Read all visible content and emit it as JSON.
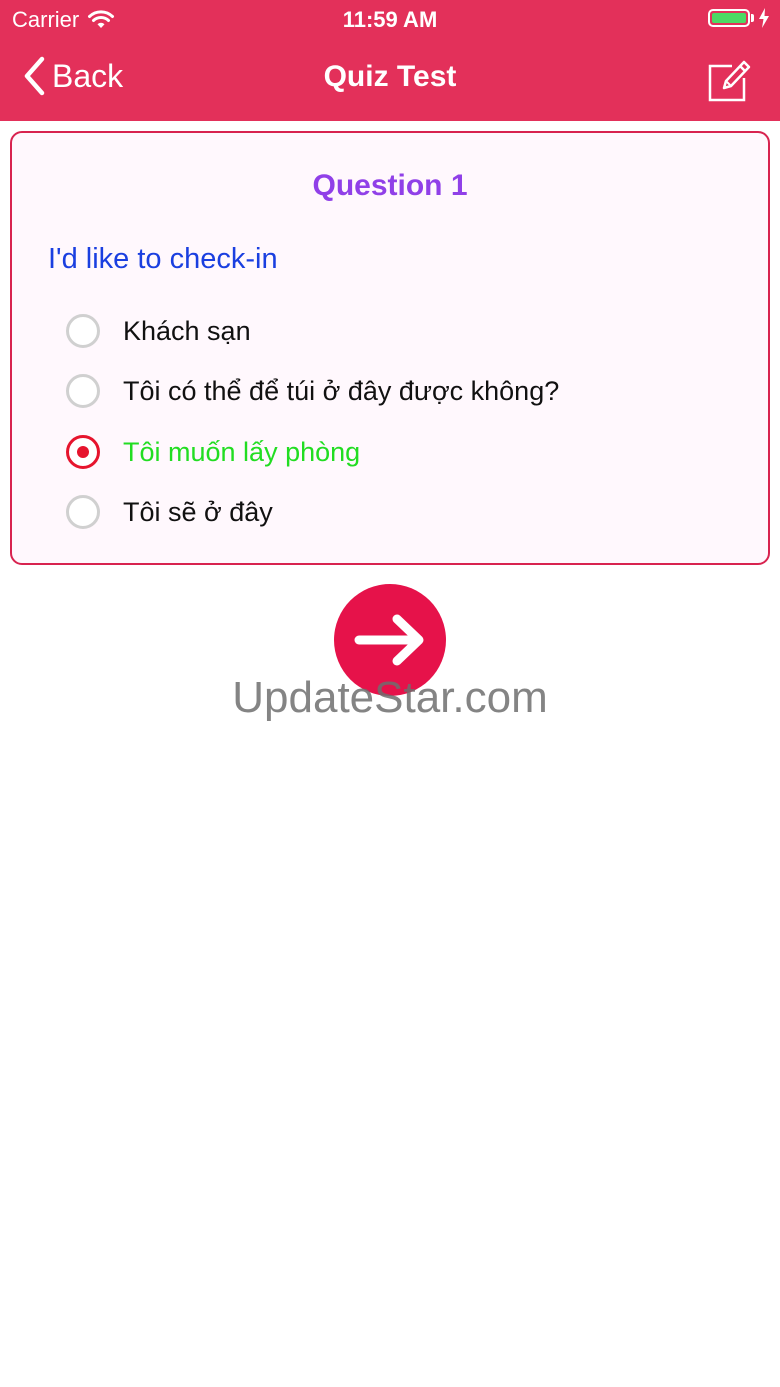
{
  "status_bar": {
    "carrier": "Carrier",
    "time": "11:59 AM",
    "battery_level": 1.0,
    "battery_color": "#4cd964"
  },
  "nav": {
    "back_label": "Back",
    "title": "Quiz Test",
    "edit_icon": "edit-icon",
    "bar_color": "#e3305a"
  },
  "quiz": {
    "question_title": "Question 1",
    "question_text": "I'd like to check-in",
    "options": [
      {
        "label": "Khách sạn",
        "selected": false,
        "correct": false
      },
      {
        "label": "Tôi có thể để túi ở đây được không?",
        "selected": false,
        "correct": false
      },
      {
        "label": "Tôi muốn lấy phòng",
        "selected": true,
        "correct": true
      },
      {
        "label": "Tôi sẽ ở đây",
        "selected": false,
        "correct": false
      }
    ]
  },
  "next_button": {
    "icon": "arrow-right-icon",
    "color": "#e6124a"
  },
  "watermark": {
    "text": "UpdateStar.com"
  }
}
